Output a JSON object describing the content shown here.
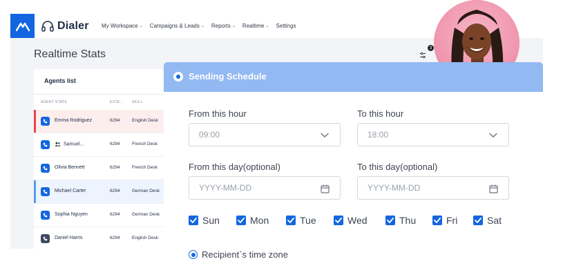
{
  "topbar": {
    "brand": "Dialer",
    "nav": [
      {
        "label": "My Workspace",
        "has_dropdown": true
      },
      {
        "label": "Campaigns & Leads",
        "has_dropdown": true
      },
      {
        "label": "Reports",
        "has_dropdown": true
      },
      {
        "label": "Realtime",
        "has_dropdown": true
      },
      {
        "label": "Settings",
        "has_dropdown": false
      }
    ],
    "chevron": "⌄"
  },
  "page": {
    "title": "Realtime Stats",
    "filter_badge": "3"
  },
  "agents": {
    "title": "Agents list",
    "columns": [
      "AGENT STATE",
      "EXTE...",
      "SKILL"
    ],
    "rows": [
      {
        "name": "Emma Rodriguez",
        "ext": "6294",
        "skill": "English Desk",
        "state": "alert"
      },
      {
        "name": "Samuel...",
        "ext": "6294",
        "skill": "French Desk",
        "state": "normal",
        "icon": "person-icon"
      },
      {
        "name": "Olivia Bennett",
        "ext": "6294",
        "skill": "French Desk",
        "state": "normal"
      },
      {
        "name": "Michael Carter",
        "ext": "6294",
        "skill": "German Desk",
        "state": "active"
      },
      {
        "name": "Sophia Nguyen",
        "ext": "6294",
        "skill": "German Desk",
        "state": "normal"
      },
      {
        "name": "Daniel Harris",
        "ext": "6294",
        "skill": "English Desk",
        "state": "offline"
      }
    ]
  },
  "schedule": {
    "title": "Sending Schedule",
    "from_hour_label": "From this hour",
    "from_hour_value": "09:00",
    "to_hour_label": "To this hour",
    "to_hour_value": "18:00",
    "from_day_label": "From this day(optional)",
    "from_day_placeholder": "YYYY-MM-DD",
    "to_day_label": "To this day(optional)",
    "to_day_placeholder": "YYYY-MM-DD",
    "days": [
      {
        "label": "Sun",
        "checked": true
      },
      {
        "label": "Mon",
        "checked": true
      },
      {
        "label": "Tue",
        "checked": true
      },
      {
        "label": "Wed",
        "checked": true
      },
      {
        "label": "Thu",
        "checked": true
      },
      {
        "label": "Fri",
        "checked": true
      },
      {
        "label": "Sat",
        "checked": true
      }
    ],
    "timezone_label": "Recipient`s time zone",
    "timezone_selected": true
  },
  "colors": {
    "accent": "#1466e0",
    "panel_header": "#93b9f2",
    "alert": "#e8424b",
    "active": "#5b9cf0"
  }
}
